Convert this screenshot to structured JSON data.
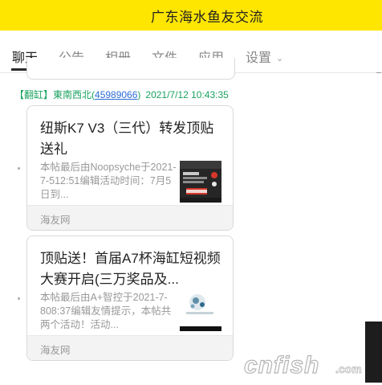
{
  "topbar": {
    "title": "广东海水鱼友交流"
  },
  "tabs": [
    {
      "label": "聊天",
      "active": true
    },
    {
      "label": "公告"
    },
    {
      "label": "相册"
    },
    {
      "label": "文件"
    },
    {
      "label": "应用"
    },
    {
      "label": "设置"
    }
  ],
  "message": {
    "tag": "【翻缸】",
    "sender": "東南西北(",
    "uid": "45989066",
    "uid_close": ")",
    "time": "2021/7/12 10:43:35"
  },
  "cards": [
    {
      "title": "纽斯K7 V3（三代）转发顶贴送礼",
      "desc": "本帖最后由Noopsyche于2021-7-512:51编辑活动时间：7月5日到...",
      "source": "海友网"
    },
    {
      "title": "顶贴送！首届A7杯海缸短视频大赛开启(三万奖品及...",
      "desc": "本帖最后由A+智控于2021-7-808:37编辑友情提示，本帖共两个活动！活动...",
      "source": "海友网"
    }
  ],
  "watermark": {
    "text": "cnfish.com"
  },
  "colors": {
    "topbar": "#ffe600",
    "sender": "#1aa260",
    "uid": "#2b6bd6"
  }
}
